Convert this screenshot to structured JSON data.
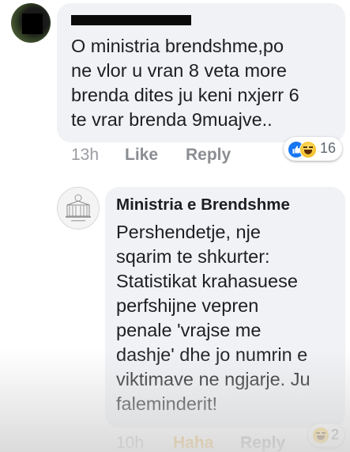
{
  "comment": {
    "text": "O ministria brendshme,po\nne vlor u vran 8 veta more\nbrenda dites  ju keni nxjerr 6\nte vrar brenda 9muajve..",
    "timestamp": "13h",
    "like_label": "Like",
    "reply_label": "Reply",
    "reactions": {
      "types": [
        "like-icon",
        "haha-icon"
      ],
      "count": "16"
    }
  },
  "reply": {
    "author": "Ministria e Brendshme",
    "text": "Pershendetje, nje\nsqarim te shkurter:\nStatistikat krahasuese\nperfshijne vepren\npenale 'vrajse me\ndashje' dhe jo numrin e\nviktimave ne ngjarje. Ju\nfaleminderit!",
    "timestamp": "10h",
    "reaction_label": "Haha",
    "reply_label": "Reply",
    "reactions": {
      "types": [
        "haha-icon"
      ],
      "count": "2"
    }
  },
  "colors": {
    "bubble": "#f0f2f5",
    "haha_accent": "#e7a013",
    "like_blue": "#1877f2",
    "meta_gray": "#8a8d91"
  }
}
